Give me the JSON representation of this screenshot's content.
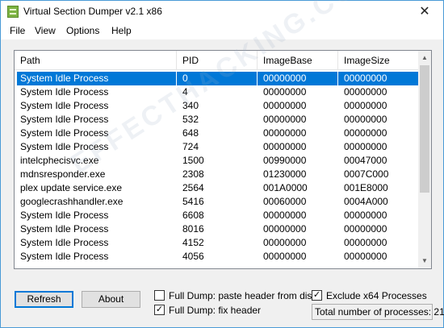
{
  "window": {
    "title": "Virtual Section Dumper v2.1 x86",
    "close_glyph": "✕"
  },
  "menu": [
    "File",
    "View",
    "Options",
    "Help"
  ],
  "table": {
    "columns": [
      "Path",
      "PID",
      "ImageBase",
      "ImageSize"
    ],
    "selected_row": 0,
    "rows": [
      [
        "System Idle Process",
        "0",
        "00000000",
        "00000000"
      ],
      [
        "System Idle Process",
        "4",
        "00000000",
        "00000000"
      ],
      [
        "System Idle Process",
        "340",
        "00000000",
        "00000000"
      ],
      [
        "System Idle Process",
        "532",
        "00000000",
        "00000000"
      ],
      [
        "System Idle Process",
        "648",
        "00000000",
        "00000000"
      ],
      [
        "System Idle Process",
        "724",
        "00000000",
        "00000000"
      ],
      [
        "intelcphecisvc.exe",
        "1500",
        "00990000",
        "00047000"
      ],
      [
        "mdnsresponder.exe",
        "2308",
        "01230000",
        "0007C000"
      ],
      [
        "plex update service.exe",
        "2564",
        "001A0000",
        "001E8000"
      ],
      [
        "googlecrashhandler.exe",
        "5416",
        "00060000",
        "0004A000"
      ],
      [
        "System Idle Process",
        "6608",
        "00000000",
        "00000000"
      ],
      [
        "System Idle Process",
        "8016",
        "00000000",
        "00000000"
      ],
      [
        "System Idle Process",
        "4152",
        "00000000",
        "00000000"
      ],
      [
        "System Idle Process",
        "4056",
        "00000000",
        "00000000"
      ]
    ]
  },
  "scrollbar": {
    "up_glyph": "▲",
    "down_glyph": "▼"
  },
  "buttons": {
    "refresh": "Refresh",
    "about": "About"
  },
  "options": {
    "full_dump_paste_header": {
      "label": "Full Dump: paste header from disk",
      "checked": false
    },
    "full_dump_fix_header": {
      "label": "Full Dump: fix header",
      "checked": true
    },
    "exclude_x64": {
      "label": "Exclude x64 Processes",
      "checked": true
    }
  },
  "status": {
    "process_count_text": "Total number of processes: 21"
  },
  "watermark": "EFFECTHACKING.COM",
  "colors": {
    "selection": "#0078d7",
    "window_border": "#4a9ad6",
    "app_icon": "#7db343"
  },
  "icons": {
    "app": "app-icon",
    "close": "close-icon",
    "check": "checkmark-icon"
  }
}
